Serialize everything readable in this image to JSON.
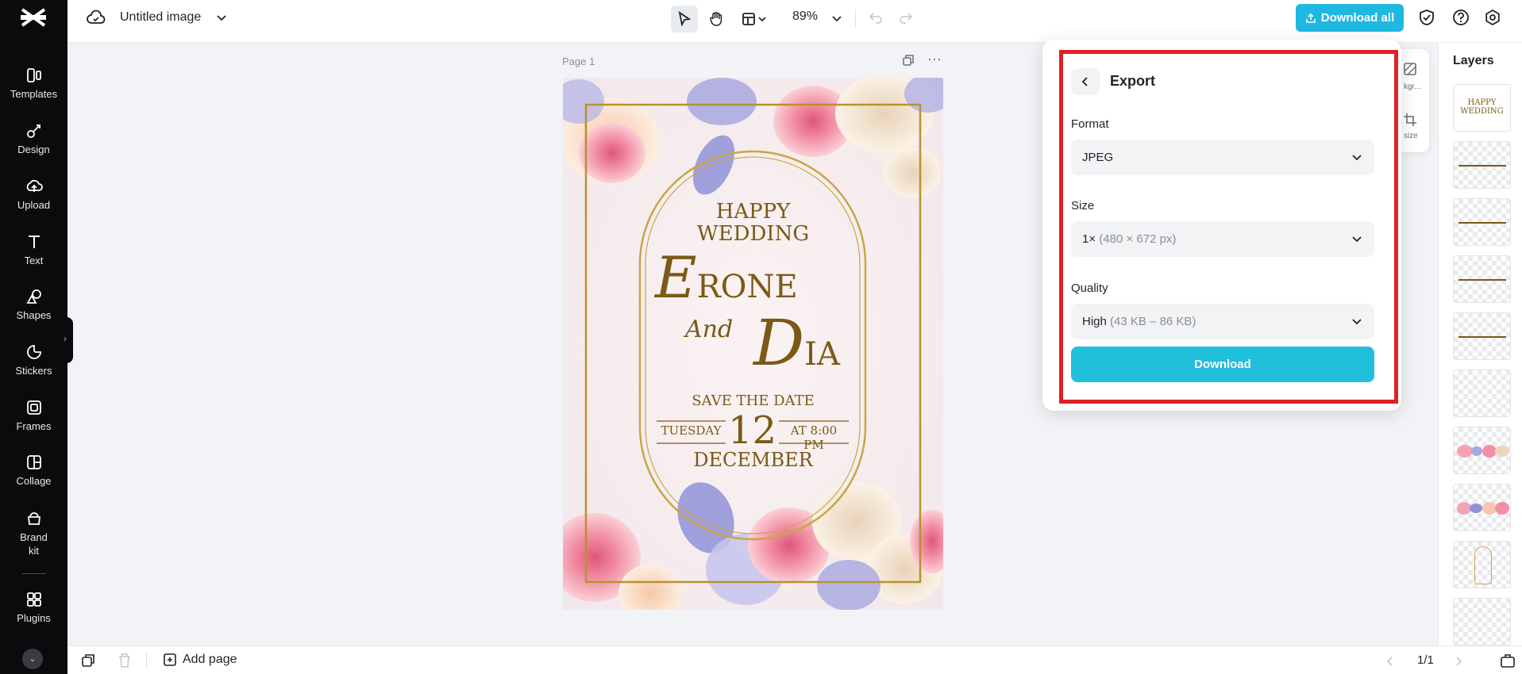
{
  "sidebar": {
    "items": [
      {
        "label": "Templates",
        "icon": "templates-icon"
      },
      {
        "label": "Design",
        "icon": "design-icon"
      },
      {
        "label": "Upload",
        "icon": "upload-icon"
      },
      {
        "label": "Text",
        "icon": "text-icon"
      },
      {
        "label": "Shapes",
        "icon": "shapes-icon"
      },
      {
        "label": "Stickers",
        "icon": "stickers-icon"
      },
      {
        "label": "Frames",
        "icon": "frames-icon"
      },
      {
        "label": "Collage",
        "icon": "collage-icon"
      },
      {
        "label": "Brand kit",
        "icon": "brand-kit-icon"
      },
      {
        "label": "Plugins",
        "icon": "plugins-icon"
      }
    ]
  },
  "topbar": {
    "title": "Untitled image",
    "zoom": "89%",
    "download_all_label": "Download all"
  },
  "canvas": {
    "page_label": "Page 1",
    "design": {
      "line1": "HAPPY",
      "line2": "WEDDING",
      "name1_initial": "E",
      "name1_rest": "RONE",
      "and": "And",
      "name2_initial": "D",
      "name2_rest": "IA",
      "save_the_date": "SAVE THE DATE",
      "day": "TUESDAY",
      "date": "12",
      "time": "AT 8:00 PM",
      "month": "DECEMBER"
    }
  },
  "side_tools": {
    "bg_label": "kgr...",
    "resize_label": "size"
  },
  "export": {
    "title": "Export",
    "format_label": "Format",
    "format_value": "JPEG",
    "size_label": "Size",
    "size_value": "1×",
    "size_detail": "(480 × 672 px)",
    "quality_label": "Quality",
    "quality_value": "High",
    "quality_detail": "(43 KB – 86 KB)",
    "download_label": "Download"
  },
  "layers": {
    "title": "Layers",
    "thumb_text_1": "HAPPY",
    "thumb_text_2": "WEDDING"
  },
  "bottombar": {
    "add_page_label": "Add page",
    "page_count": "1/1"
  },
  "colors": {
    "accent": "#1fb8e0",
    "highlight": "#e01f26",
    "gold": "#7a5a16"
  }
}
